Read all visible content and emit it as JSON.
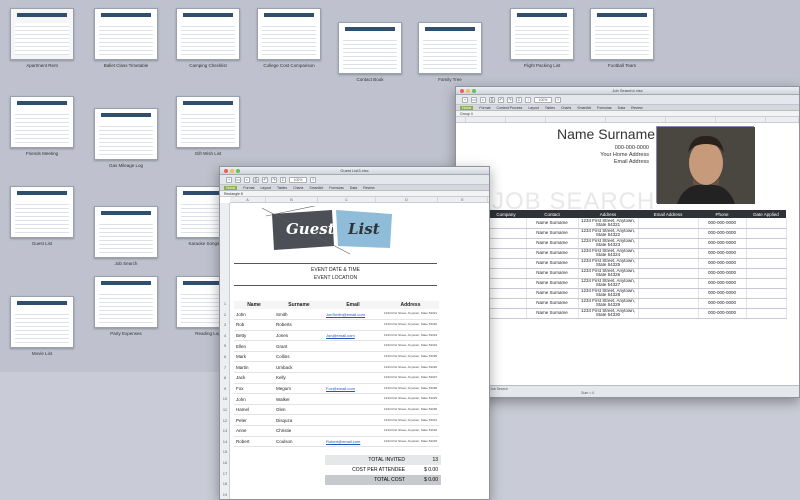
{
  "gallery": {
    "templates": [
      {
        "label": "Apartment Rent"
      },
      {
        "label": "Ballet Class Timetable"
      },
      {
        "label": "Camping Checklist"
      },
      {
        "label": "College Cost Comparison"
      },
      {
        "label": "Contact Book"
      },
      {
        "label": "Family Tree"
      },
      {
        "label": "Flight Packing List"
      },
      {
        "label": "Football Team"
      },
      {
        "label": "Friends Meeting"
      },
      {
        "label": "Gas Mileage Log"
      },
      {
        "label": "Gift Wish List"
      },
      {
        "label": "Guest List"
      },
      {
        "label": "Job Search"
      },
      {
        "label": "Karaoke Songs List"
      },
      {
        "label": "Movie List"
      },
      {
        "label": "Party Expenses"
      },
      {
        "label": "Reading Log"
      }
    ]
  },
  "job_window": {
    "title": "Job Search4.xlsx",
    "zoom": "100%",
    "tabs": [
      "Home",
      "Format",
      "Content Process",
      "Layout",
      "Tables",
      "Charts",
      "SmartArt",
      "Formulas",
      "Data",
      "Review"
    ],
    "name_box": "Group 4",
    "name": "Name Surname",
    "phone": "000-000-0000",
    "address": "Your Home Address",
    "email": "Email Address",
    "watermark": "JOB SEARCH",
    "columns": [
      "Company",
      "Contact",
      "Address",
      "Email Address",
      "Phone",
      "Date Applied"
    ],
    "rows": [
      {
        "contact": "Name Surname",
        "address": "1234 First Street, Anytown, State 54321",
        "phone": "000-000-0000"
      },
      {
        "contact": "Name Surname",
        "address": "1234 First Street, Anytown, State 54322",
        "phone": "000-000-0000"
      },
      {
        "contact": "Name Surname",
        "address": "1234 First Street, Anytown, State 54323",
        "phone": "000-000-0000"
      },
      {
        "contact": "Name Surname",
        "address": "1234 First Street, Anytown, State 54324",
        "phone": "000-000-0000"
      },
      {
        "contact": "Name Surname",
        "address": "1234 First Street, Anytown, State 54325",
        "phone": "000-000-0000"
      },
      {
        "contact": "Name Surname",
        "address": "1234 First Street, Anytown, State 54326",
        "phone": "000-000-0000"
      },
      {
        "contact": "Name Surname",
        "address": "1234 First Street, Anytown, State 54327",
        "phone": "000-000-0000"
      },
      {
        "contact": "Name Surname",
        "address": "1234 First Street, Anytown, State 54328",
        "phone": "000-000-0000"
      },
      {
        "contact": "Name Surname",
        "address": "1234 First Street, Anytown, State 54329",
        "phone": "000-000-0000"
      },
      {
        "contact": "Name Surname",
        "address": "1234 First Street, Anytown, State 54330",
        "phone": "000-000-0000"
      }
    ],
    "sheet_tab": "Job Search",
    "status_left": "Ready",
    "status_right": "Sum = 0"
  },
  "guest_window": {
    "title": "Guest List3.xlsx",
    "zoom": "100%",
    "tabs": [
      "Home",
      "Format",
      "Layout",
      "Tables",
      "Charts",
      "SmartArt",
      "Formulas",
      "Data",
      "Review"
    ],
    "name_box": "Rectangle 8",
    "col_letters": [
      "A",
      "B",
      "C",
      "D",
      "E"
    ],
    "banner_word1": "Guest",
    "banner_word2": "List",
    "event_date": "EVENT DATE & TIME",
    "event_location": "EVENT LOCATION",
    "headers": [
      "Name",
      "Surname",
      "Email",
      "Address"
    ],
    "guests": [
      {
        "name": "John",
        "surname": "Smith",
        "email": "JonSmith@email.com",
        "address": "1234 First Street, Anytown, State 54321"
      },
      {
        "name": "Rob",
        "surname": "Roberts",
        "email": "",
        "address": "1234 First Street, Anytown, State 54322"
      },
      {
        "name": "Betty",
        "surname": "Jones",
        "email": "Jon@email.com",
        "address": "1234 First Street, Anytown, State 54323"
      },
      {
        "name": "Ellen",
        "surname": "Grant",
        "email": "",
        "address": "1234 First Street, Anytown, State 54324"
      },
      {
        "name": "Mark",
        "surname": "Collins",
        "email": "",
        "address": "1234 First Street, Anytown, State 54325"
      },
      {
        "name": "Martin",
        "surname": "Umback",
        "email": "",
        "address": "1234 First Street, Anytown, State 54326"
      },
      {
        "name": "Jack",
        "surname": "Kelly",
        "email": "",
        "address": "1234 First Street, Anytown, State 54327"
      },
      {
        "name": "Fox",
        "surname": "Megum",
        "email": "Fox@email.com",
        "address": "1234 First Street, Anytown, State 54328"
      },
      {
        "name": "John",
        "surname": "Walker",
        "email": "",
        "address": "1234 First Street, Anytown, State 54329"
      },
      {
        "name": "Hamel",
        "surname": "Glen",
        "email": "",
        "address": "1234 First Street, Anytown, State 54330"
      },
      {
        "name": "Peter",
        "surname": "Disquza",
        "email": "",
        "address": "1234 First Street, Anytown, State 54331"
      },
      {
        "name": "Anne",
        "surname": "Christie",
        "email": "",
        "address": "1234 First Street, Anytown, State 54332"
      },
      {
        "name": "Robert",
        "surname": "Coulson",
        "email": "Robert@email.com",
        "address": "1234 First Street, Anytown, State 54333"
      }
    ],
    "totals": [
      {
        "label": "TOTAL INVITED",
        "value": "13"
      },
      {
        "label": "COST PER ATTENDEE",
        "value": "$ 0.00"
      },
      {
        "label": "TOTAL COST",
        "value": "$ 0.00"
      }
    ]
  }
}
